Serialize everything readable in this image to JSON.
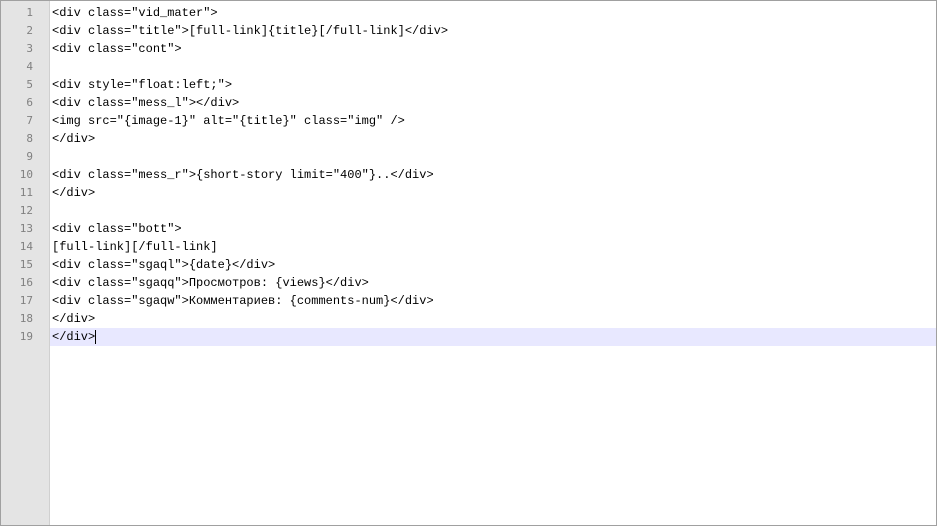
{
  "editor": {
    "current_line": 19,
    "lines": [
      {
        "num": "1",
        "text": "<div class=\"vid_mater\">"
      },
      {
        "num": "2",
        "text": "<div class=\"title\">[full-link]{title}[/full-link]</div>"
      },
      {
        "num": "3",
        "text": "<div class=\"cont\">"
      },
      {
        "num": "4",
        "text": ""
      },
      {
        "num": "5",
        "text": "<div style=\"float:left;\">"
      },
      {
        "num": "6",
        "text": "<div class=\"mess_l\"></div>"
      },
      {
        "num": "7",
        "text": "<img src=\"{image-1}\" alt=\"{title}\" class=\"img\" />"
      },
      {
        "num": "8",
        "text": "</div>"
      },
      {
        "num": "9",
        "text": ""
      },
      {
        "num": "10",
        "text": "<div class=\"mess_r\">{short-story limit=\"400\"}..</div>"
      },
      {
        "num": "11",
        "text": "</div>"
      },
      {
        "num": "12",
        "text": ""
      },
      {
        "num": "13",
        "text": "<div class=\"bott\">"
      },
      {
        "num": "14",
        "text": "[full-link][/full-link]"
      },
      {
        "num": "15",
        "text": "<div class=\"sgaql\">{date}</div>"
      },
      {
        "num": "16",
        "text": "<div class=\"sgaqq\">Просмотров: {views}</div>"
      },
      {
        "num": "17",
        "text": "<div class=\"sgaqw\">Комментариев: {comments-num}</div>"
      },
      {
        "num": "18",
        "text": "</div>"
      },
      {
        "num": "19",
        "text": "</div>"
      }
    ]
  }
}
